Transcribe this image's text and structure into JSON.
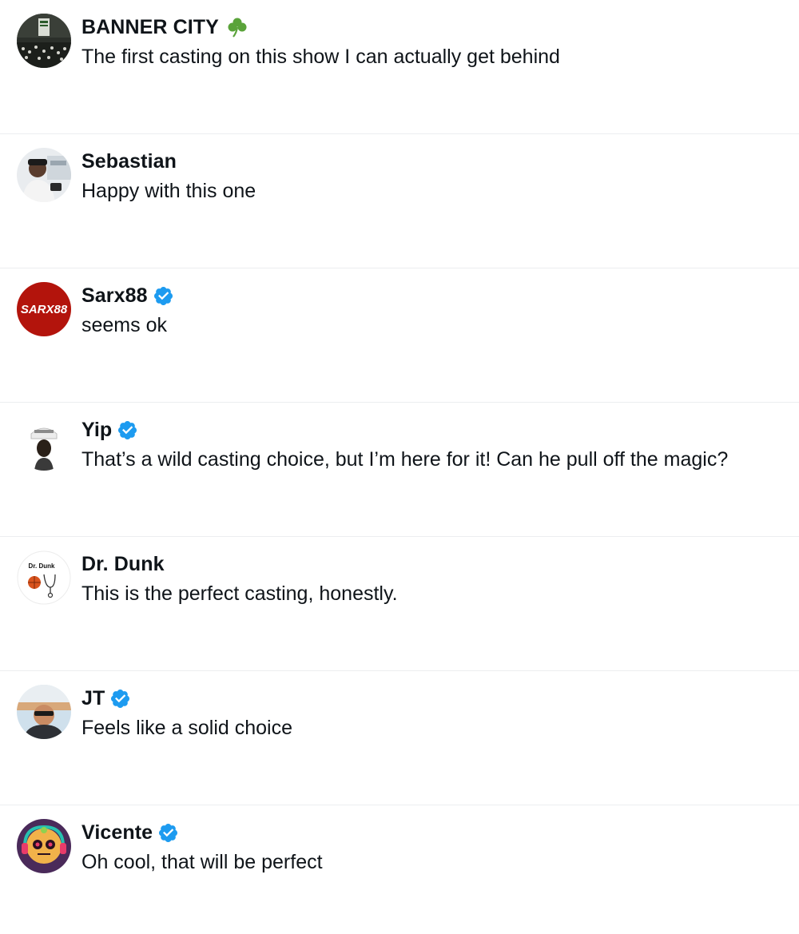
{
  "replies": [
    {
      "name": "BANNER CITY",
      "text": "The first casting on this show I can actually get behind"
    },
    {
      "name": "Sebastian",
      "text": "Happy with this one"
    },
    {
      "name": "Sarx88",
      "avatar_text": "SARX88",
      "text": "seems ok"
    },
    {
      "name": "Yip",
      "text": "That’s a wild casting choice, but I’m here for it! Can he pull off the magic?"
    },
    {
      "name": "Dr. Dunk",
      "avatar_text": "Dr. Dunk",
      "text": "This is the perfect casting, honestly."
    },
    {
      "name": "JT",
      "text": "Feels like a solid choice"
    },
    {
      "name": "Vicente",
      "text": "Oh cool, that will be perfect"
    }
  ],
  "colors": {
    "verified": "#1d9bf0",
    "clover": "#5aa33a",
    "text": "#0f1419",
    "divider": "#eceef0",
    "sarx_red": "#b3140c"
  },
  "icons": {
    "verified": "verified-badge-icon",
    "clover": "shamrock-icon"
  }
}
